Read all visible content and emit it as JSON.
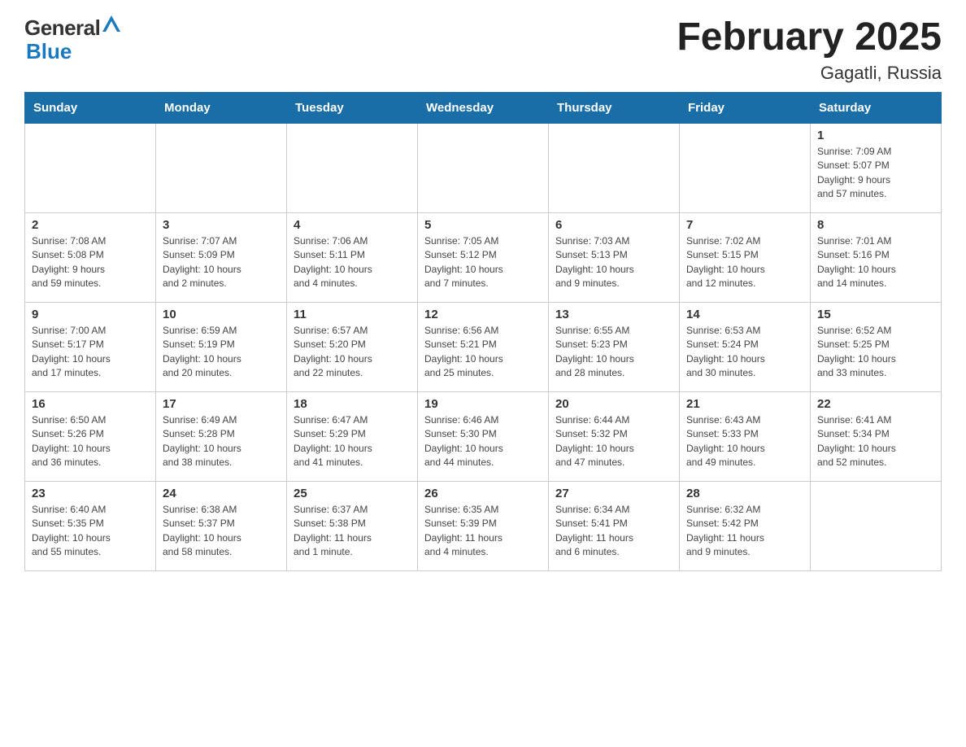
{
  "header": {
    "logo_general": "General",
    "logo_blue": "Blue",
    "month_title": "February 2025",
    "location": "Gagatli, Russia"
  },
  "calendar": {
    "days_of_week": [
      "Sunday",
      "Monday",
      "Tuesday",
      "Wednesday",
      "Thursday",
      "Friday",
      "Saturday"
    ],
    "weeks": [
      [
        {
          "day": "",
          "info": ""
        },
        {
          "day": "",
          "info": ""
        },
        {
          "day": "",
          "info": ""
        },
        {
          "day": "",
          "info": ""
        },
        {
          "day": "",
          "info": ""
        },
        {
          "day": "",
          "info": ""
        },
        {
          "day": "1",
          "info": "Sunrise: 7:09 AM\nSunset: 5:07 PM\nDaylight: 9 hours\nand 57 minutes."
        }
      ],
      [
        {
          "day": "2",
          "info": "Sunrise: 7:08 AM\nSunset: 5:08 PM\nDaylight: 9 hours\nand 59 minutes."
        },
        {
          "day": "3",
          "info": "Sunrise: 7:07 AM\nSunset: 5:09 PM\nDaylight: 10 hours\nand 2 minutes."
        },
        {
          "day": "4",
          "info": "Sunrise: 7:06 AM\nSunset: 5:11 PM\nDaylight: 10 hours\nand 4 minutes."
        },
        {
          "day": "5",
          "info": "Sunrise: 7:05 AM\nSunset: 5:12 PM\nDaylight: 10 hours\nand 7 minutes."
        },
        {
          "day": "6",
          "info": "Sunrise: 7:03 AM\nSunset: 5:13 PM\nDaylight: 10 hours\nand 9 minutes."
        },
        {
          "day": "7",
          "info": "Sunrise: 7:02 AM\nSunset: 5:15 PM\nDaylight: 10 hours\nand 12 minutes."
        },
        {
          "day": "8",
          "info": "Sunrise: 7:01 AM\nSunset: 5:16 PM\nDaylight: 10 hours\nand 14 minutes."
        }
      ],
      [
        {
          "day": "9",
          "info": "Sunrise: 7:00 AM\nSunset: 5:17 PM\nDaylight: 10 hours\nand 17 minutes."
        },
        {
          "day": "10",
          "info": "Sunrise: 6:59 AM\nSunset: 5:19 PM\nDaylight: 10 hours\nand 20 minutes."
        },
        {
          "day": "11",
          "info": "Sunrise: 6:57 AM\nSunset: 5:20 PM\nDaylight: 10 hours\nand 22 minutes."
        },
        {
          "day": "12",
          "info": "Sunrise: 6:56 AM\nSunset: 5:21 PM\nDaylight: 10 hours\nand 25 minutes."
        },
        {
          "day": "13",
          "info": "Sunrise: 6:55 AM\nSunset: 5:23 PM\nDaylight: 10 hours\nand 28 minutes."
        },
        {
          "day": "14",
          "info": "Sunrise: 6:53 AM\nSunset: 5:24 PM\nDaylight: 10 hours\nand 30 minutes."
        },
        {
          "day": "15",
          "info": "Sunrise: 6:52 AM\nSunset: 5:25 PM\nDaylight: 10 hours\nand 33 minutes."
        }
      ],
      [
        {
          "day": "16",
          "info": "Sunrise: 6:50 AM\nSunset: 5:26 PM\nDaylight: 10 hours\nand 36 minutes."
        },
        {
          "day": "17",
          "info": "Sunrise: 6:49 AM\nSunset: 5:28 PM\nDaylight: 10 hours\nand 38 minutes."
        },
        {
          "day": "18",
          "info": "Sunrise: 6:47 AM\nSunset: 5:29 PM\nDaylight: 10 hours\nand 41 minutes."
        },
        {
          "day": "19",
          "info": "Sunrise: 6:46 AM\nSunset: 5:30 PM\nDaylight: 10 hours\nand 44 minutes."
        },
        {
          "day": "20",
          "info": "Sunrise: 6:44 AM\nSunset: 5:32 PM\nDaylight: 10 hours\nand 47 minutes."
        },
        {
          "day": "21",
          "info": "Sunrise: 6:43 AM\nSunset: 5:33 PM\nDaylight: 10 hours\nand 49 minutes."
        },
        {
          "day": "22",
          "info": "Sunrise: 6:41 AM\nSunset: 5:34 PM\nDaylight: 10 hours\nand 52 minutes."
        }
      ],
      [
        {
          "day": "23",
          "info": "Sunrise: 6:40 AM\nSunset: 5:35 PM\nDaylight: 10 hours\nand 55 minutes."
        },
        {
          "day": "24",
          "info": "Sunrise: 6:38 AM\nSunset: 5:37 PM\nDaylight: 10 hours\nand 58 minutes."
        },
        {
          "day": "25",
          "info": "Sunrise: 6:37 AM\nSunset: 5:38 PM\nDaylight: 11 hours\nand 1 minute."
        },
        {
          "day": "26",
          "info": "Sunrise: 6:35 AM\nSunset: 5:39 PM\nDaylight: 11 hours\nand 4 minutes."
        },
        {
          "day": "27",
          "info": "Sunrise: 6:34 AM\nSunset: 5:41 PM\nDaylight: 11 hours\nand 6 minutes."
        },
        {
          "day": "28",
          "info": "Sunrise: 6:32 AM\nSunset: 5:42 PM\nDaylight: 11 hours\nand 9 minutes."
        },
        {
          "day": "",
          "info": ""
        }
      ]
    ]
  }
}
